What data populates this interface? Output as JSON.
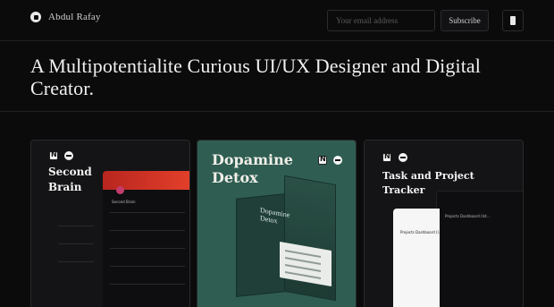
{
  "header": {
    "brand_name": "Abdul Rafay",
    "email_placeholder": "Your email address",
    "subscribe_label": "Subscribe"
  },
  "hero": {
    "headline": "A Multipotentialite Curious UI/UX Designer and Digital Creator."
  },
  "cards": [
    {
      "title_line1": "Second",
      "title_line2": "Brain",
      "preview_heading": "Second Brain"
    },
    {
      "title_line1": "Dopamine",
      "title_line2": "Detox",
      "box_line1": "Dopamine",
      "box_line2": "Detox"
    },
    {
      "title_line1": "Task and Project",
      "title_line2": "Tracker",
      "preview_heading": "Projects Dashboard (Int...",
      "white_heading": "Projects Dashboard (I..."
    }
  ],
  "colors": {
    "background": "#0b0b0c",
    "card_dopamine": "#2f5d52",
    "accent_red": "#e4402a"
  },
  "icons": [
    "notion-icon",
    "face-icon",
    "menu-icon",
    "logo-icon"
  ]
}
